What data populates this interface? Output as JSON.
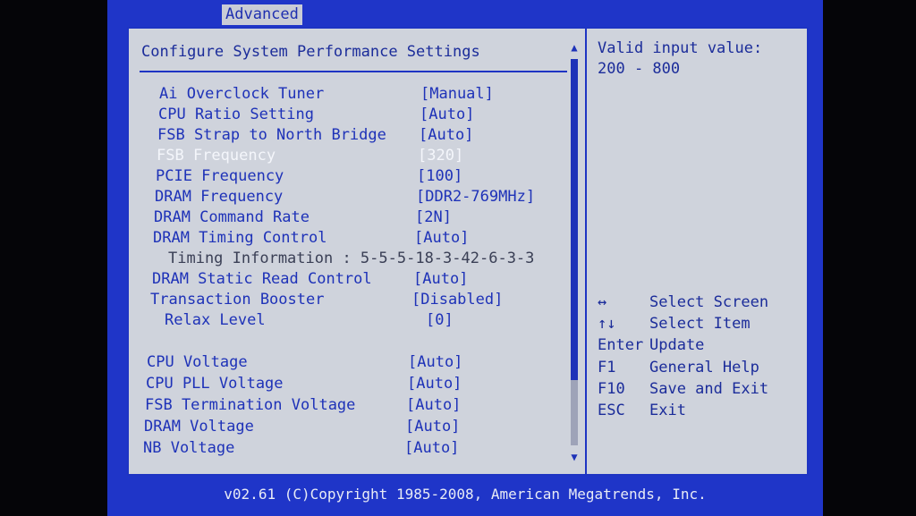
{
  "tab": {
    "label": "Advanced"
  },
  "main": {
    "title": "Configure System Performance Settings",
    "rows": [
      {
        "label": "Ai Overclock Tuner",
        "value": "[Manual]"
      },
      {
        "label": "CPU Ratio Setting",
        "value": "[Auto]"
      },
      {
        "label": "FSB Strap to North Bridge",
        "value": "[Auto]"
      },
      {
        "label": "FSB Frequency",
        "value": "[320]",
        "selected": true
      },
      {
        "label": "PCIE Frequency",
        "value": "[100]"
      },
      {
        "label": "DRAM Frequency",
        "value": "[DDR2-769MHz]"
      },
      {
        "label": "DRAM Command Rate",
        "value": "[2N]"
      },
      {
        "label": "DRAM Timing Control",
        "value": "[Auto]"
      },
      {
        "label": "Timing Information : 5-5-5-18-3-42-6-3-3",
        "value": "",
        "info": true
      },
      {
        "label": "DRAM Static Read Control",
        "value": "[Auto]"
      },
      {
        "label": "Transaction Booster",
        "value": "[Disabled]"
      },
      {
        "label": "Relax Level",
        "value": "[0]",
        "indent": true
      },
      {
        "label": "CPU Voltage",
        "value": "[Auto]"
      },
      {
        "label": "CPU PLL Voltage",
        "value": "[Auto]"
      },
      {
        "label": "FSB Termination Voltage",
        "value": "[Auto]"
      },
      {
        "label": "DRAM Voltage",
        "value": "[Auto]"
      },
      {
        "label": "NB Voltage",
        "value": "[Auto]"
      }
    ],
    "scroll_fraction": 0.83
  },
  "help": {
    "title": "Valid input value:",
    "value": "200 - 800",
    "keys": [
      {
        "key": "↔",
        "desc": "Select Screen"
      },
      {
        "key": "↑↓",
        "desc": "Select Item"
      },
      {
        "key": "Enter",
        "desc": "Update"
      },
      {
        "key": "F1",
        "desc": "General Help"
      },
      {
        "key": "F10",
        "desc": "Save and Exit"
      },
      {
        "key": "ESC",
        "desc": "Exit"
      }
    ]
  },
  "footer": {
    "text": "v02.61 (C)Copyright 1985-2008, American Megatrends, Inc."
  },
  "colors": {
    "screen_bg": "#1f35c8",
    "panel_bg": "#cfd3dc",
    "text": "#1e32b8",
    "selected_text": "#f4f6fb"
  }
}
